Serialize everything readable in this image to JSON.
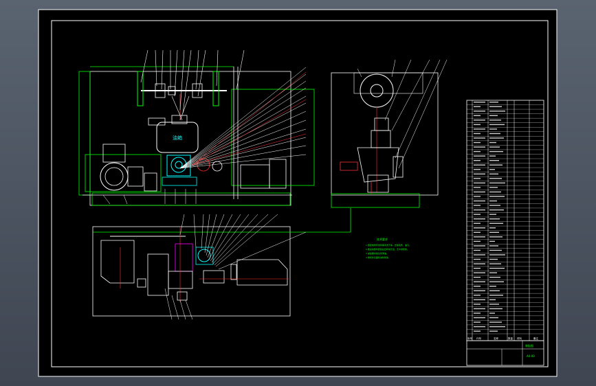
{
  "drawing": {
    "notes_title": "技术要求",
    "notes_lines": [
      "1.装配前所有零件需清洗干净，去除毛刺、油污。",
      "2.各运动部件装配后应转动灵活，无卡滞现象。",
      "3.减速器内加注润滑油。",
      "4.整机外表面喷涂防锈漆。"
    ],
    "front_view_label": "油箱",
    "title_block": {
      "headers": [
        "序号",
        "代号",
        "名称",
        "数量",
        "材料",
        "备注"
      ],
      "drawing_name": "装配图",
      "drawing_no": "A0-00"
    },
    "colors": {
      "sheet": "#000000",
      "frame": "#ffffff",
      "outline": "#00ff00",
      "parts": "#ffffff",
      "leaders": "#ff3030",
      "cyan": "#00ffff",
      "magenta": "#ff00ff",
      "yellow": "#ffff00"
    }
  }
}
